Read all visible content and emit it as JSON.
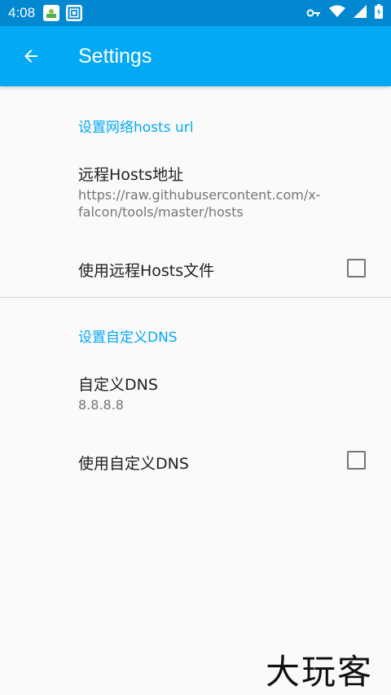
{
  "status_bar": {
    "time": "4:08",
    "icons": [
      "app-icon",
      "screenshot-icon",
      "vpn-key-icon",
      "wifi-icon",
      "signal-icon",
      "battery-icon"
    ]
  },
  "app_bar": {
    "title": "Settings",
    "back_icon": "arrow-back-icon"
  },
  "sections": [
    {
      "category": "设置网络hosts url",
      "items": [
        {
          "title": "远程Hosts地址",
          "summary": "https://raw.githubusercontent.com/x-falcon/tools/master/hosts"
        },
        {
          "title": "使用远程Hosts文件",
          "checked": false
        }
      ]
    },
    {
      "category": "设置自定义DNS",
      "items": [
        {
          "title": "自定义DNS",
          "summary": "8.8.8.8"
        },
        {
          "title": "使用自定义DNS",
          "checked": false
        }
      ]
    }
  ],
  "watermark": "大玩客",
  "colors": {
    "status_bar": "#0288d1",
    "app_bar": "#03a9f4",
    "accent": "#03a9f4",
    "background": "#fafafa"
  }
}
